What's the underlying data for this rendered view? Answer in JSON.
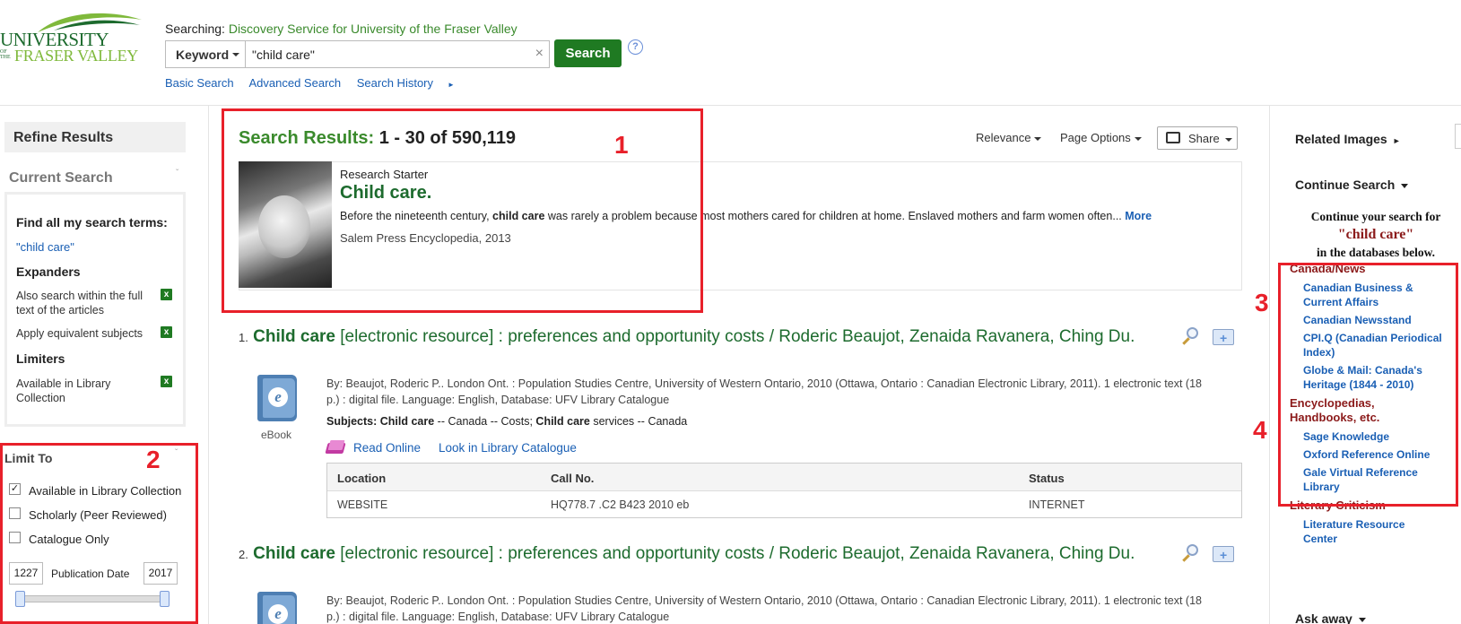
{
  "header": {
    "logo_line1": "UNIVERSITY",
    "logo_of_the": "OF THE",
    "logo_line2": "FRASER VALLEY",
    "searching_label": "Searching: ",
    "searching_source": "Discovery Service for University of the Fraser Valley",
    "field_select": "Keyword",
    "query": "\"child care\"",
    "clear_glyph": "×",
    "search_button": "Search",
    "help_glyph": "?",
    "links": [
      "Basic Search",
      "Advanced Search",
      "Search History"
    ],
    "history_arrow": "►"
  },
  "left": {
    "refine_title": "Refine Results",
    "current_search_title": "Current Search",
    "collapse_glyph": "ˇ",
    "find_all_heading": "Find all my search terms:",
    "find_all_term": "\"child care\"",
    "expanders_heading": "Expanders",
    "expander1": "Also search within the full text of the articles",
    "expander2": "Apply equivalent subjects",
    "limiters_heading": "Limiters",
    "limiter1": "Available in Library Collection",
    "remove_glyph": "x",
    "limit_to_title": "Limit To",
    "limit_options": [
      {
        "label": "Available in Library Collection",
        "checked": true
      },
      {
        "label": "Scholarly (Peer Reviewed)",
        "checked": false
      },
      {
        "label": "Catalogue Only",
        "checked": false
      }
    ],
    "check_glyph": "✓",
    "date_from": "1227",
    "date_label": "Publication Date",
    "date_to": "2017"
  },
  "main": {
    "results_label": "Search Results:",
    "results_count": "1 - 30 of 590,119",
    "toolbar": [
      "Relevance",
      "Page Options",
      "Share"
    ],
    "research_starter": {
      "label": "Research Starter",
      "title": "Child care.",
      "desc_pre": "Before the nineteenth century, ",
      "desc_bold": "child care",
      "desc_post": " was rarely a problem because most mothers cared for children at home. Enslaved mothers and farm women often...",
      "more": "More",
      "source": "Salem Press Encyclopedia, 2013"
    },
    "results": [
      {
        "num": "1.",
        "title_bold": "Child care",
        "title_rest": " [electronic resource] : preferences and opportunity costs / Roderic Beaujot, Zenaida Ravanera, Ching Du.",
        "type": "eBook",
        "meta": "By: Beaujot, Roderic P.. London Ont. : Population Studies Centre, University of Western Ontario, 2010 (Ottawa, Ontario : Canadian Electronic Library, 2011). 1 electronic text (18 p.) : digital file. Language: English, Database: UFV Library Catalogue",
        "subjects_label": "Subjects:",
        "subj1_bold": "Child care",
        "subj1_rest": " -- Canada -- Costs; ",
        "subj2_bold": "Child care",
        "subj2_rest": " services -- Canada",
        "link_read": "Read Online",
        "link_catalogue": "Look in Library Catalogue",
        "table_headers": [
          "Location",
          "Call No.",
          "Status"
        ],
        "table_row": [
          "WEBSITE",
          "HQ778.7 .C2 B423 2010 eb",
          "INTERNET"
        ]
      },
      {
        "num": "2.",
        "title_bold": "Child care",
        "title_rest": " [electronic resource] : preferences and opportunity costs / Roderic Beaujot, Zenaida Ravanera, Ching Du.",
        "meta": "By: Beaujot, Roderic P.. London Ont. : Population Studies Centre, University of Western Ontario, 2010 (Ottawa, Ontario : Canadian Electronic Library, 2011). 1 electronic text (18 p.) : digital file. Language: English, Database: UFV Library Catalogue"
      }
    ],
    "add_folder_glyph": "+"
  },
  "right": {
    "related_images": "Related Images",
    "related_arrow": "►",
    "continue_search": "Continue Search",
    "continue_line1": "Continue your search for",
    "continue_query": "\"child care\"",
    "continue_line2": "in the databases below.",
    "cat_canada": "Canada/News",
    "canada_dbs": [
      "Canadian Business & Current Affairs",
      "Canadian Newsstand",
      "CPI.Q (Canadian Periodical Index)",
      "Globe & Mail: Canada's Heritage (1844 - 2010)"
    ],
    "cat_encyc": "Encyclopedias, Handbooks, etc.",
    "encyc_dbs": [
      "Sage Knowledge",
      "Oxford Reference Online",
      "Gale Virtual Reference Library"
    ],
    "cat_lit": "Literary Criticism",
    "lit_dbs": [
      "Literature Resource Center"
    ],
    "ask_away": "Ask away"
  },
  "annotations": [
    "1",
    "2",
    "3",
    "4"
  ],
  "colors": {
    "brand_green": "#1d6b2e",
    "search_button": "#1f7a22",
    "link_blue": "#1a5fb4",
    "category_red": "#8b1a1a",
    "annotation_red": "#e8202a"
  }
}
